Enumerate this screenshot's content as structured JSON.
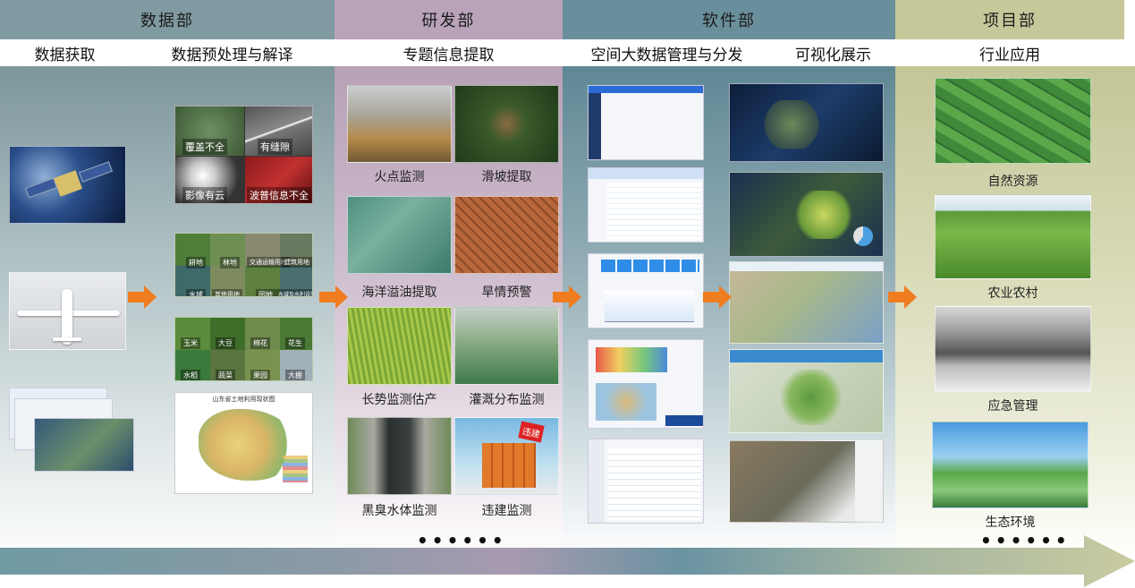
{
  "sections": {
    "data_dept": "数据部",
    "rd_dept": "研发部",
    "software_dept": "软件部",
    "project_dept": "项目部"
  },
  "stages": {
    "acquisition": "数据获取",
    "preprocess": "数据预处理与解译",
    "extraction": "专题信息提取",
    "management": "空间大数据管理与分发",
    "visualization": "可视化展示",
    "application": "行业应用"
  },
  "preprocess_tags": [
    "覆盖不全",
    "有缝隙",
    "影像有云",
    "波普信息不全"
  ],
  "landcover_tags": [
    "耕地",
    "林地",
    "交通运输用地",
    "建筑用地",
    "水域",
    "其他用地",
    "园地",
    "水域及水利设施用地"
  ],
  "crop_tags": [
    "玉米",
    "大豆",
    "棉花",
    "花生",
    "水稻",
    "蔬菜",
    "果园",
    "大棚"
  ],
  "map_title": "山东省土地利用现状图",
  "rd_labels": [
    "火点监测",
    "滑坡提取",
    "海洋溢油提取",
    "旱情预警",
    "长势监测估产",
    "灌溉分布监测",
    "黑臭水体监测",
    "违建监测"
  ],
  "illegal_sign": "违建",
  "app_labels": [
    "自然资源",
    "农业农村",
    "应急管理",
    "生态环境"
  ],
  "ellipsis": "••••••",
  "colors": {
    "data_header": "#7f9aa1",
    "rd_header": "#b9a3b9",
    "software_header": "#6a8f9c",
    "project_header": "#c6c89a",
    "arrow": "#ef7d20"
  }
}
